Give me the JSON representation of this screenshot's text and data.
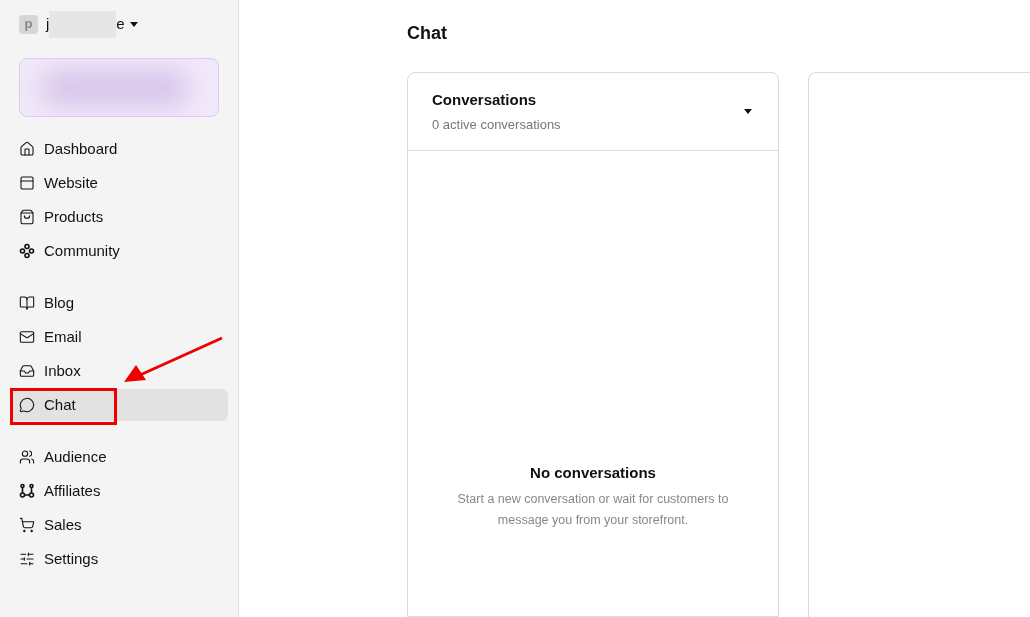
{
  "workspace": {
    "avatar_letter": "p",
    "name_start": "j",
    "name_end": "e"
  },
  "sidebar": {
    "groups": [
      {
        "items": [
          {
            "label": "Dashboard",
            "selected": false
          },
          {
            "label": "Website",
            "selected": false
          },
          {
            "label": "Products",
            "selected": false
          },
          {
            "label": "Community",
            "selected": false
          }
        ]
      },
      {
        "items": [
          {
            "label": "Blog",
            "selected": false
          },
          {
            "label": "Email",
            "selected": false
          },
          {
            "label": "Inbox",
            "selected": false
          },
          {
            "label": "Chat",
            "selected": true
          }
        ]
      },
      {
        "items": [
          {
            "label": "Audience",
            "selected": false
          },
          {
            "label": "Affiliates",
            "selected": false
          },
          {
            "label": "Sales",
            "selected": false
          },
          {
            "label": "Settings",
            "selected": false
          }
        ]
      }
    ]
  },
  "page": {
    "title": "Chat"
  },
  "conversations": {
    "title": "Conversations",
    "subtitle": "0 active conversations",
    "empty_title": "No conversations",
    "empty_text": "Start a new conversation or wait for customers to message you from your storefront."
  }
}
